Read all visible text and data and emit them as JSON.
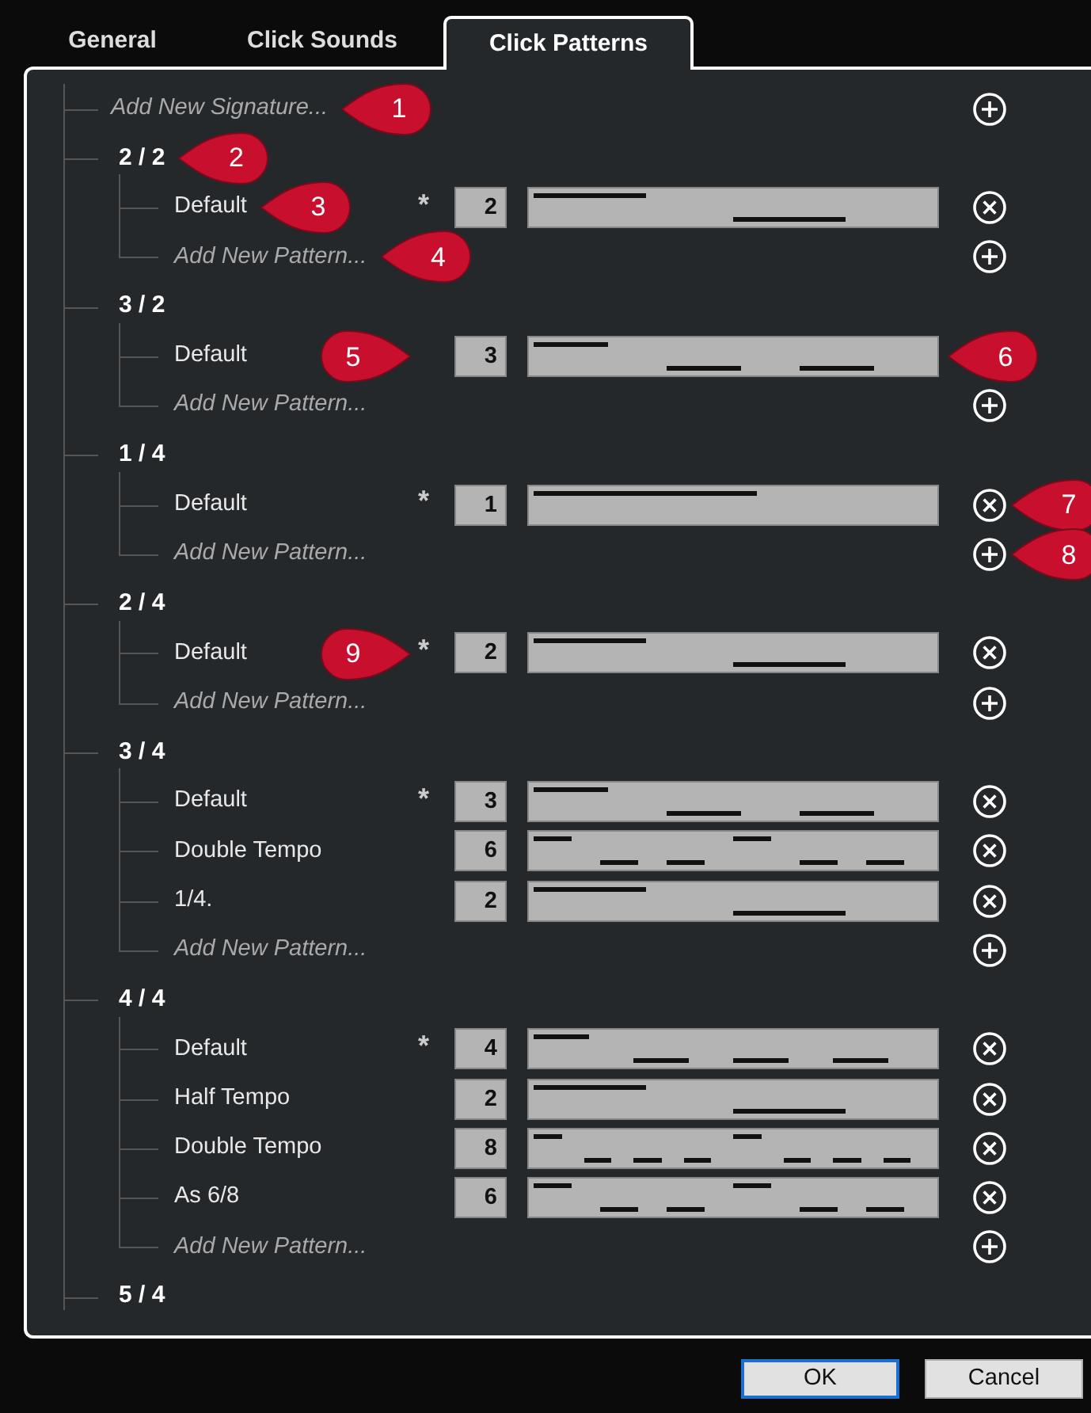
{
  "tabs": [
    {
      "label": "General",
      "selected": false
    },
    {
      "label": "Click Sounds",
      "selected": false
    },
    {
      "label": "Click Patterns",
      "selected": true
    }
  ],
  "tree": [
    {
      "kind": "add",
      "label": "Add New Signature...",
      "callout": {
        "number": "1",
        "kind": "label"
      }
    },
    {
      "kind": "signature",
      "label": "2 / 2",
      "callout": {
        "number": "2",
        "kind": "label"
      },
      "children": [
        {
          "kind": "pattern",
          "label": "Default",
          "marker": "*",
          "count": "2",
          "accents": [
            true,
            false
          ],
          "callout": {
            "number": "3",
            "kind": "label"
          }
        },
        {
          "kind": "add",
          "label": "Add New Pattern...",
          "callout": {
            "number": "4",
            "kind": "label"
          }
        }
      ]
    },
    {
      "kind": "signature",
      "label": "3 / 2",
      "children": [
        {
          "kind": "pattern",
          "label": "Default",
          "count": "3",
          "accents": [
            true,
            false,
            false
          ],
          "callout": {
            "number": "5",
            "kind": "star"
          },
          "callout2": {
            "number": "6",
            "kind": "bar"
          }
        },
        {
          "kind": "add",
          "label": "Add New Pattern..."
        }
      ]
    },
    {
      "kind": "signature",
      "label": "1 / 4",
      "children": [
        {
          "kind": "pattern",
          "label": "Default",
          "marker": "*",
          "count": "1",
          "accents": [
            true
          ],
          "callout": {
            "number": "7",
            "kind": "action"
          }
        },
        {
          "kind": "add",
          "label": "Add New Pattern...",
          "callout": {
            "number": "8",
            "kind": "action"
          }
        }
      ]
    },
    {
      "kind": "signature",
      "label": "2 / 4",
      "children": [
        {
          "kind": "pattern",
          "label": "Default",
          "marker": "*",
          "count": "2",
          "accents": [
            true,
            false
          ],
          "callout": {
            "number": "9",
            "kind": "star"
          }
        },
        {
          "kind": "add",
          "label": "Add New Pattern..."
        }
      ]
    },
    {
      "kind": "signature",
      "label": "3 / 4",
      "children": [
        {
          "kind": "pattern",
          "label": "Default",
          "marker": "*",
          "count": "3",
          "accents": [
            true,
            false,
            false
          ]
        },
        {
          "kind": "pattern",
          "label": "Double Tempo",
          "count": "6",
          "accents": [
            true,
            false,
            false,
            true,
            false,
            false
          ]
        },
        {
          "kind": "pattern",
          "label": "1/4.",
          "count": "2",
          "accents": [
            true,
            false
          ]
        },
        {
          "kind": "add",
          "label": "Add New Pattern..."
        }
      ]
    },
    {
      "kind": "signature",
      "label": "4 / 4",
      "children": [
        {
          "kind": "pattern",
          "label": "Default",
          "marker": "*",
          "count": "4",
          "accents": [
            true,
            false,
            false,
            false
          ]
        },
        {
          "kind": "pattern",
          "label": "Half Tempo",
          "count": "2",
          "accents": [
            true,
            false
          ]
        },
        {
          "kind": "pattern",
          "label": "Double Tempo",
          "count": "8",
          "accents": [
            true,
            false,
            false,
            false,
            true,
            false,
            false,
            false
          ]
        },
        {
          "kind": "pattern",
          "label": "As 6/8",
          "count": "6",
          "accents": [
            true,
            false,
            false,
            true,
            false,
            false
          ]
        },
        {
          "kind": "add",
          "label": "Add New Pattern..."
        }
      ]
    },
    {
      "kind": "signature",
      "label": "5 / 4"
    }
  ],
  "buttons": [
    {
      "label": "OK",
      "focused": true
    },
    {
      "label": "Cancel",
      "focused": false
    }
  ]
}
